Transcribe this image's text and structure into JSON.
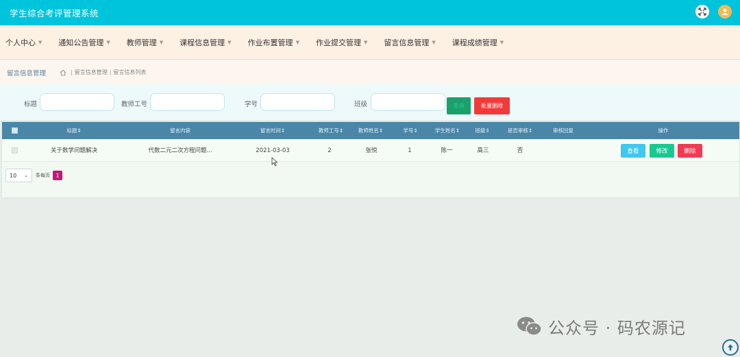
{
  "header": {
    "title": "学生综合考评管理系统",
    "icons": [
      "fullscreen-icon",
      "user-avatar-icon"
    ],
    "bg_color": "#00c3dc"
  },
  "nav": {
    "items": [
      {
        "label": "个人中心"
      },
      {
        "label": "通知公告管理"
      },
      {
        "label": "教师管理"
      },
      {
        "label": "课程信息管理"
      },
      {
        "label": "作业布置管理"
      },
      {
        "label": "作业提交管理"
      },
      {
        "label": "留言信息管理"
      },
      {
        "label": "课程成绩管理"
      }
    ]
  },
  "breadcrumb": {
    "module": "留言信息管理",
    "path": [
      "留言信息管理",
      "留言信息列表"
    ]
  },
  "search": {
    "fields": [
      {
        "label": "标题",
        "value": ""
      },
      {
        "label": "教师工号",
        "value": ""
      },
      {
        "label": "学号",
        "value": ""
      },
      {
        "label": "班级",
        "value": ""
      }
    ],
    "search_label": "查询",
    "batch_delete_label": "批量删除"
  },
  "table": {
    "columns": [
      "标题",
      "留言内容",
      "留言时间",
      "教师工号",
      "教师姓名",
      "学号",
      "学生姓名",
      "班级",
      "是否审核",
      "审核回复",
      "操作"
    ],
    "rows": [
      {
        "title": "关于数学问题解决",
        "content": "代数二元二次方程问题...",
        "time": "2021-03-03",
        "teacher_no": "2",
        "teacher_name": "张悦",
        "student_no": "1",
        "student_name": "陈一",
        "class": "高三",
        "reviewed": "否",
        "reply": ""
      }
    ],
    "actions": {
      "view": "查看",
      "edit": "修改",
      "delete": "删除"
    }
  },
  "pager": {
    "page_size": "10",
    "per_page_label": "条每页",
    "current_page": "1"
  },
  "watermark": "公众号 · 码农源记"
}
